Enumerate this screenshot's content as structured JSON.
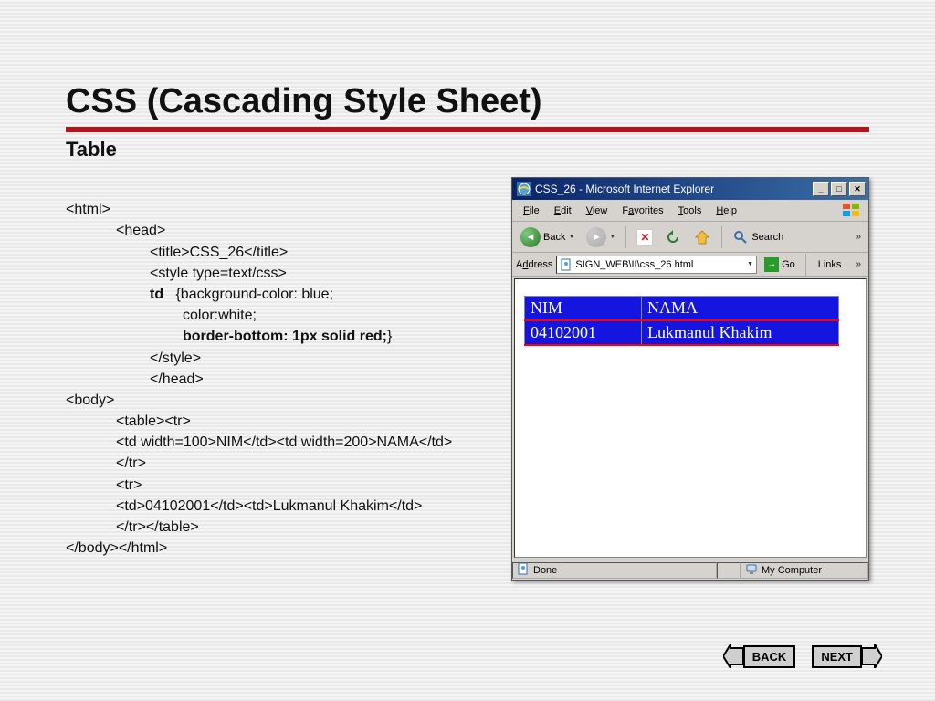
{
  "slide": {
    "title": "CSS (Cascading Style Sheet)",
    "subtitle": "Table"
  },
  "code": {
    "l0": "<html>",
    "l1": "<head>",
    "l2": "<title>CSS_26</title>",
    "l3": "<style type=text/css>",
    "l4a": "td",
    "l4b": "{background-color: blue;",
    "l5": "color:white;",
    "l6": "border-bottom: 1px solid red;",
    "l6b": "}",
    "l7": "</style>",
    "l8": "</head>",
    "l9": "<body>",
    "l10": "<table><tr>",
    "l11": "<td width=100>NIM</td><td width=200>NAMA</td>",
    "l12": "</tr>",
    "l13": "<tr>",
    "l14": "<td>04102001</td><td>Lukmanul Khakim</td>",
    "l15": "</tr></table>",
    "l16": "</body></html>"
  },
  "ie": {
    "title": "CSS_26 - Microsoft Internet Explorer",
    "menu": {
      "file": "File",
      "edit": "Edit",
      "view": "View",
      "favorites": "Favorites",
      "tools": "Tools",
      "help": "Help"
    },
    "toolbar": {
      "back": "Back",
      "search": "Search"
    },
    "address": {
      "label": "Address",
      "value": "SIGN_WEB\\II\\css_26.html",
      "go": "Go",
      "links": "Links"
    },
    "table": {
      "h1": "NIM",
      "h2": "NAMA",
      "r1c1": "04102001",
      "r1c2": "Lukmanul Khakim"
    },
    "status": {
      "done": "Done",
      "zone": "My Computer"
    }
  },
  "nav": {
    "back": "BACK",
    "next": "NEXT"
  }
}
